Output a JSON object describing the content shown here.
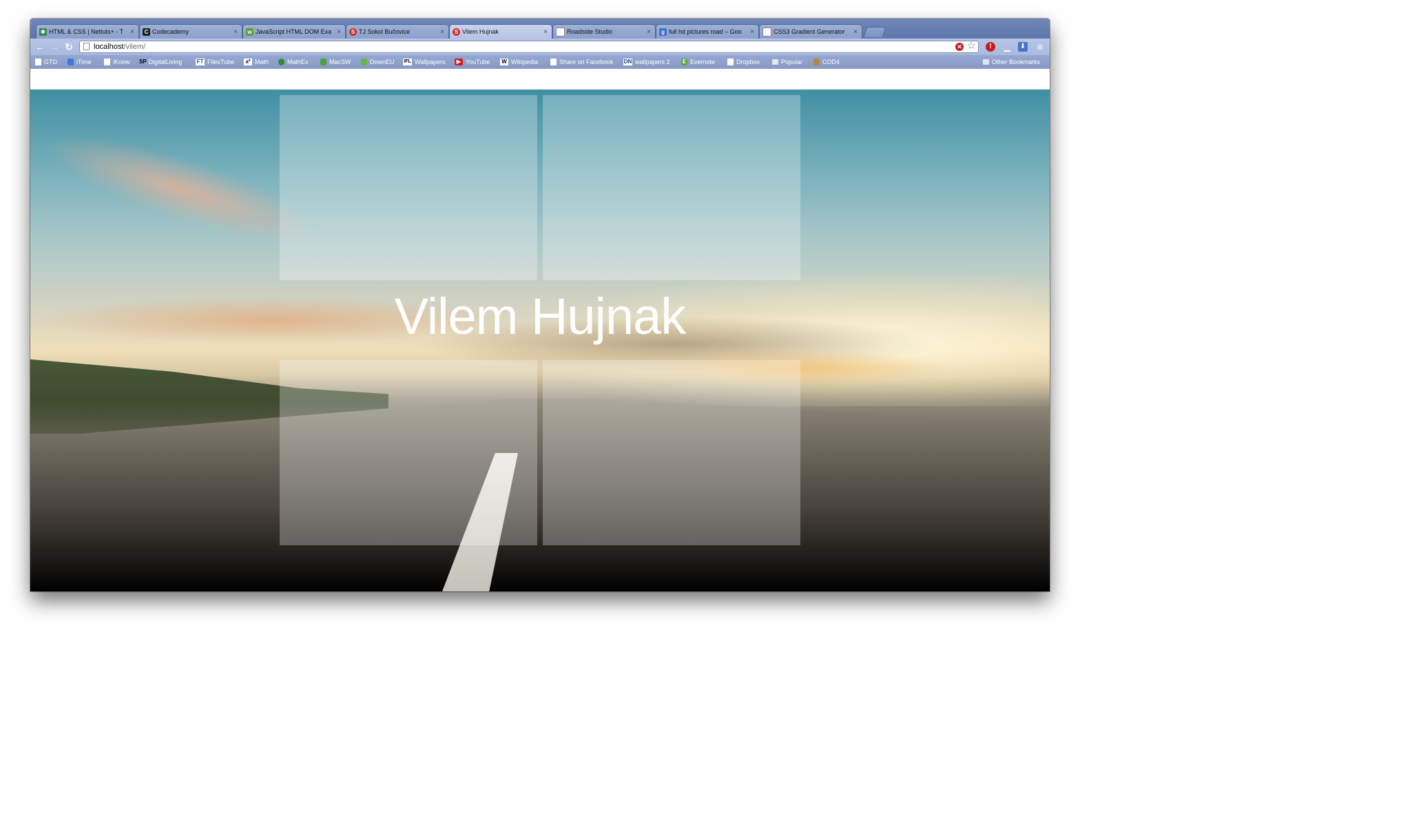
{
  "browser": {
    "tabs": [
      {
        "label": "HTML & CSS | Nettuts+ - T",
        "icon": "nettuts-favicon-icon",
        "active": false
      },
      {
        "label": "Codecademy",
        "icon": "codecademy-favicon-icon",
        "active": false
      },
      {
        "label": "JavaScript HTML DOM Exa",
        "icon": "w3schools-favicon-icon",
        "active": false
      },
      {
        "label": "TJ Sokol Bučovice",
        "icon": "sokol-favicon-icon",
        "active": false
      },
      {
        "label": "Vilem Hujnak",
        "icon": "sokol-favicon-icon",
        "active": true
      },
      {
        "label": "Roadside Studio",
        "icon": "page-icon",
        "active": false
      },
      {
        "label": "full hd pictures road – Goo",
        "icon": "google-favicon-icon",
        "active": false
      },
      {
        "label": "CSS3 Gradient Generator",
        "icon": "page-icon",
        "active": false
      }
    ],
    "close_glyph": "×",
    "address": {
      "host": "localhost",
      "path": "/vilem/"
    },
    "bookmarks": [
      {
        "label": "GTD",
        "icon": "page-icon"
      },
      {
        "label": "iTime",
        "icon": "itime-icon"
      },
      {
        "label": "iKnow",
        "icon": "page-icon"
      },
      {
        "label": "DigitalLiving",
        "icon": "sp-icon"
      },
      {
        "label": "FilesTube",
        "icon": "filestube-icon"
      },
      {
        "label": "Math",
        "icon": "math-icon"
      },
      {
        "label": "MathEx",
        "icon": "mathex-icon"
      },
      {
        "label": "MacSW",
        "icon": "macsw-icon"
      },
      {
        "label": "DownEU",
        "icon": "download-icon"
      },
      {
        "label": "Wallpapers",
        "icon": "ifl-icon"
      },
      {
        "label": "YouTube",
        "icon": "youtube-icon"
      },
      {
        "label": "Wikipedia",
        "icon": "wikipedia-icon"
      },
      {
        "label": "Share on Facebook",
        "icon": "page-icon"
      },
      {
        "label": "wallpapers 2",
        "icon": "dn-icon"
      },
      {
        "label": "Evernote",
        "icon": "evernote-icon"
      },
      {
        "label": "Dropbox",
        "icon": "page-icon"
      },
      {
        "label": "Popular",
        "icon": "folder-icon"
      },
      {
        "label": "COD4",
        "icon": "cod4-icon"
      }
    ],
    "other_bookmarks": "Other Bookmarks",
    "bookmark_glyphs": {
      "sp": "SP",
      "filestube": "FT",
      "math": "x²",
      "wikipedia": "W",
      "dn": "DN",
      "evernote": "E",
      "ifl": "IFL"
    }
  },
  "page": {
    "title": "Vilem Hujnak"
  },
  "colors": {
    "tab_strip": "#6f87b9",
    "bookmark_bar": "#8799c4",
    "hero_title": "#ffffff"
  }
}
